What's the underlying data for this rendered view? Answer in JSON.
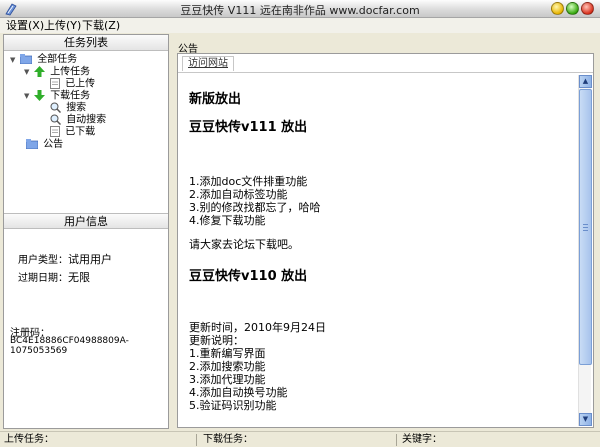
{
  "window": {
    "title": "豆豆快传 V111  远在南非作品 www.docfar.com"
  },
  "menu": [
    {
      "label": "设置(X)"
    },
    {
      "label": "上传(Y)"
    },
    {
      "label": "下载(Z)"
    }
  ],
  "task_panel": {
    "header": "任务列表",
    "tree": [
      {
        "label": "全部任务",
        "icon": "folder-icon"
      },
      {
        "label": "上传任务",
        "icon": "upload-arrow-icon"
      },
      {
        "label": "已上传",
        "icon": "document-icon"
      },
      {
        "label": "下载任务",
        "icon": "download-arrow-icon"
      },
      {
        "label": "搜索",
        "icon": "magnifier-icon"
      },
      {
        "label": "自动搜索",
        "icon": "magnifier-icon"
      },
      {
        "label": "已下载",
        "icon": "document-icon"
      },
      {
        "label": "公告",
        "icon": "folder-icon"
      }
    ]
  },
  "user_info": {
    "header": "用户信息",
    "type_label": "用户类型：",
    "type_value": "试用用户",
    "expire_label": "过期日期：",
    "expire_value": "无限",
    "reg_label": "注册码：",
    "reg_value": "BC4E18886CF04988809A-1075053569"
  },
  "announcement": {
    "title": "公告",
    "tab": "访问网站",
    "heading1": "新版放出",
    "heading2": "豆豆快传v111 放出",
    "items1": [
      "1.添加doc文件排重功能",
      "2.添加自动标签功能",
      "3.别的修改找都忘了，哈哈",
      "4.修复下载功能"
    ],
    "note": "请大家去论坛下载吧。",
    "heading3": "豆豆快传v110 放出",
    "update_time": "更新时间，2010年9月24日",
    "update_desc": "更新说明：",
    "items2": [
      "1.重新编写界面",
      "2.添加搜索功能",
      "3.添加代理功能",
      "4.添加自动换号功能",
      "5.验证码识别功能"
    ]
  },
  "status": {
    "upload_label": "上传任务：",
    "download_label": "下载任务：",
    "keyword_label": "关键字："
  }
}
